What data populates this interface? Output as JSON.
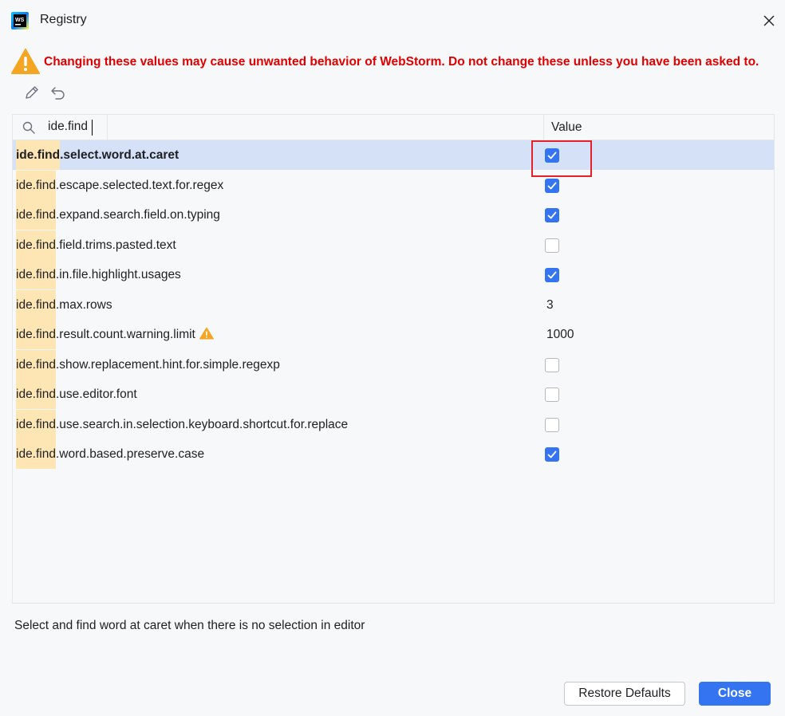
{
  "window": {
    "title": "Registry",
    "app_icon": "webstorm-icon",
    "close_icon": "close-icon"
  },
  "warning": {
    "icon": "warning-icon",
    "text": "Changing these values may cause unwanted behavior of WebStorm. Do not change these unless you have been asked to.",
    "color": "#e00000"
  },
  "toolbar": {
    "edit_icon": "pencil-icon",
    "revert_icon": "undo-icon"
  },
  "table": {
    "search": {
      "icon": "search-icon",
      "value": "ide.find",
      "placeholder": ""
    },
    "value_header": "Value",
    "highlight_prefix": "ide.find",
    "rows": [
      {
        "suffix": ".select.word.at.caret",
        "type": "checkbox",
        "checked": true,
        "selected": true
      },
      {
        "suffix": ".escape.selected.text.for.regex",
        "type": "checkbox",
        "checked": true
      },
      {
        "suffix": ".expand.search.field.on.typing",
        "type": "checkbox",
        "checked": true
      },
      {
        "suffix": ".field.trims.pasted.text",
        "type": "checkbox",
        "checked": false
      },
      {
        "suffix": ".in.file.highlight.usages",
        "type": "checkbox",
        "checked": true
      },
      {
        "suffix": ".max.rows",
        "type": "text",
        "value": "3"
      },
      {
        "suffix": ".result.count.warning.limit",
        "type": "text",
        "value": "1000",
        "warning": true
      },
      {
        "suffix": ".show.replacement.hint.for.simple.regexp",
        "type": "checkbox",
        "checked": false
      },
      {
        "suffix": ".use.editor.font",
        "type": "checkbox",
        "checked": false
      },
      {
        "suffix": ".use.search.in.selection.keyboard.shortcut.for.replace",
        "type": "checkbox",
        "checked": false
      },
      {
        "suffix": ".word.based.preserve.case",
        "type": "checkbox",
        "checked": true
      }
    ]
  },
  "description": "Select and find word at caret when there is no selection in editor",
  "buttons": {
    "restore": "Restore Defaults",
    "close": "Close"
  },
  "colors": {
    "accent": "#3574f0",
    "selected_row": "#d5e1f7",
    "match_highlight": "#fde6b3",
    "annotation_box": "#e8202a"
  }
}
